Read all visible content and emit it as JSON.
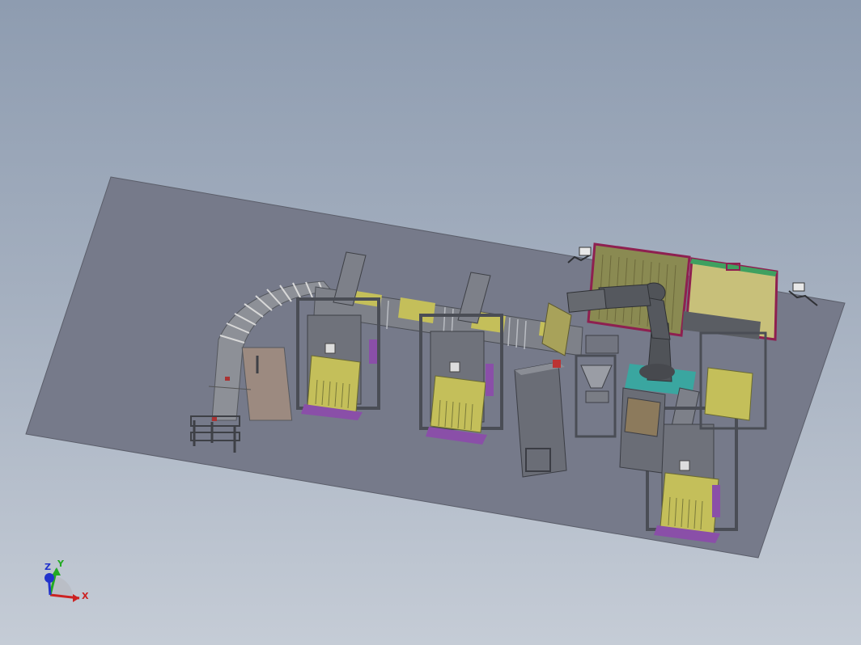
{
  "window": {
    "title": ""
  },
  "scene": {
    "description_visible": false,
    "colors": {
      "background_top": "#8e9cb0",
      "background_bottom": "#c5ccd6",
      "floor_plate": "#767a8a",
      "frame_metal": "#6b6e78",
      "pallet_yellow": "#c4bf5a",
      "pallet_base": "#8a4fa8",
      "robot_cell_frame": "#8e2050",
      "robot_cell_green_trim": "#3fa060",
      "robot_body": "#505358",
      "teal_station": "#3aa6a0",
      "conveyor_grey": "#8d9097"
    }
  },
  "triad": {
    "x_label": "X",
    "y_label": "Y",
    "z_label": "Z",
    "x_color": "#cc2222",
    "y_color": "#22aa22",
    "z_color": "#2233cc"
  }
}
